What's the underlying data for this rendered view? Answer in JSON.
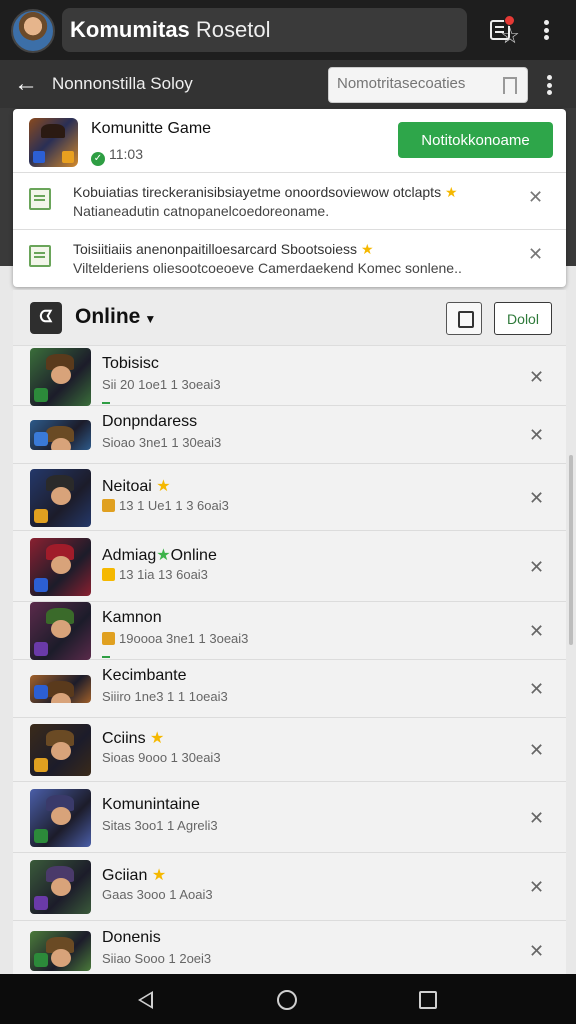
{
  "topbar": {
    "title_bold": "Komumitas",
    "title_rest": "Rosetol",
    "icons": [
      "avatar",
      "star-icon",
      "notification-icon",
      "more-vert-icon"
    ],
    "notification_dot_color": "#e53935"
  },
  "subbar": {
    "title": "Nonnonstilla Soloy",
    "search_placeholder": "Nomotritasecoaties",
    "icons": [
      "back-arrow-icon",
      "bookmark-icon",
      "more-vert-icon"
    ]
  },
  "game_card": {
    "name": "Komunitte Game",
    "time": "11:03",
    "action_label": "Notitokkonoame",
    "accent": "#2ea64a"
  },
  "notifications": [
    {
      "line1": "Kobuiatias tireckeranisibsiayetme onoordsoviewow otclapts",
      "line2": "Natianeadutin catnopanelcoedoreoname."
    },
    {
      "line1": "Toisiitiaiis anenonpaitilloesarcard Sbootsoiess",
      "line2": "Viltelderiens oliesootcoeoeve Camerdaekend Komec sonlene.."
    }
  ],
  "friends_panel": {
    "filter_label": "Online",
    "secondary_action": "Dolol",
    "close_glyph": "✕",
    "rows": [
      {
        "name": "Tobisisc",
        "status_suffix": "",
        "meta": "Sii 20 1oe1 1 3oeai3",
        "pic": "#3a6e3a",
        "hat": "#5a3a1c",
        "badge": "#2c8a3a",
        "mbadge": "",
        "online_line": true
      },
      {
        "name": "Donpndaress",
        "status_suffix": "",
        "meta": "Sioao 3ne1 1 30eai3",
        "pic": "#2d5a8a",
        "hat": "#6a4a24",
        "badge": "#3a7ad8",
        "mbadge": "",
        "online_line": false
      },
      {
        "name": "Neitoai",
        "status_suffix": "",
        "meta": "13 1 Ue1 1 3 6oai3",
        "pic": "#24386a",
        "hat": "#2a2a2a",
        "badge": "#e0a020",
        "mbadge": "#e0a020",
        "online_line": false,
        "star": true
      },
      {
        "name": "Admiag",
        "status_suffix": "Online",
        "meta": "13 1ia 13 6oai3",
        "pic": "#8a2030",
        "hat": "#a01c2a",
        "badge": "#2c5fd3",
        "mbadge": "#f5b800",
        "online_line": false,
        "gstar": true
      },
      {
        "name": "Kamnon",
        "status_suffix": "",
        "meta": "19oooa 3ne1 1 3oeai3",
        "pic": "#5a2a4a",
        "hat": "#3a6a2a",
        "badge": "#6a3aa8",
        "mbadge": "#e0a020",
        "online_line": true
      },
      {
        "name": "Kecimbante",
        "status_suffix": "",
        "meta": "Siiiro 1ne3 1 1 1oeai3",
        "pic": "#a0602a",
        "hat": "#5a3a1c",
        "badge": "#2c5fd3",
        "mbadge": "",
        "online_line": false
      },
      {
        "name": "Cciins",
        "status_suffix": "",
        "meta": "Sioas 9ooo 1 30eai3",
        "pic": "#3a2a1a",
        "hat": "#6a4a24",
        "badge": "#e0a020",
        "mbadge": "",
        "online_line": false,
        "star": true
      },
      {
        "name": "Komunintaine",
        "status_suffix": "",
        "meta": "Sitas 3oo1 1 Agreli3",
        "pic": "#4a5ea8",
        "hat": "#3a3a6a",
        "badge": "#2c8a3a",
        "mbadge": "",
        "online_line": false
      },
      {
        "name": "Gciian",
        "status_suffix": "",
        "meta": "Gaas 3ooo 1 Aoai3",
        "pic": "#3a5a3a",
        "hat": "#4a3a6a",
        "badge": "#6a3aa8",
        "mbadge": "",
        "online_line": false,
        "star": true
      },
      {
        "name": "Donenis",
        "status_suffix": "",
        "meta": "Siiao Sooo 1 2oei3",
        "pic": "#4a7a3a",
        "hat": "#6a4a24",
        "badge": "#2c8a3a",
        "mbadge": "",
        "online_line": false
      }
    ]
  },
  "navbar": {
    "icons": [
      "nav-back-icon",
      "nav-home-icon",
      "nav-recents-icon"
    ]
  }
}
